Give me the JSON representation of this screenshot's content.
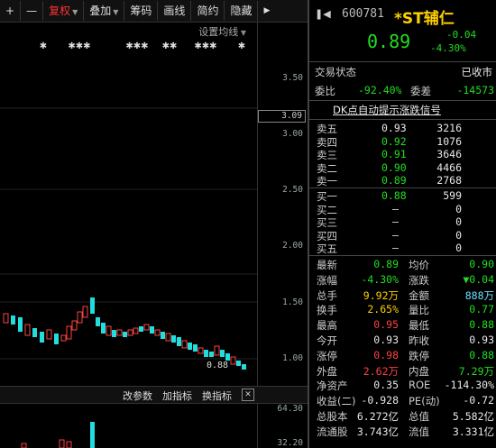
{
  "toolbar": {
    "plus": "+",
    "minus": "—",
    "fuquan": "复权",
    "diejia": "叠加",
    "chouma": "筹码",
    "huaxian": "画线",
    "jianyue": "简约",
    "yincang": "隐藏",
    "more": "▶"
  },
  "chart": {
    "avg_setting": "设置均线",
    "star_marks": [
      "✱",
      "✱✱✱",
      "✱✱✱",
      "✱✱",
      "✱✱✱",
      "✱"
    ],
    "y_ticks": [
      "3.50",
      "3.00",
      "2.50",
      "2.00",
      "1.50",
      "1.00"
    ],
    "current_price_tag": "3.09",
    "low_label": "0.88",
    "sub_ticks": [
      "64.30",
      "32.20"
    ],
    "sub_toolbar": {
      "change_params": "改参数",
      "add_indicator": "加指标",
      "switch_indicator": "换指标",
      "close": "✕"
    }
  },
  "quote": {
    "code": "600781",
    "name": "*ST辅仁",
    "price": "0.89",
    "change": "-0.04",
    "change_pct": "-4.30%",
    "status_label": "交易状态",
    "status_value": "已收市",
    "weibi_label": "委比",
    "weibi_value": "-92.40%",
    "weicha_label": "委差",
    "weicha_value": "-14573",
    "signal_link": "DK点自动提示涨跌信号"
  },
  "order_book": {
    "asks": [
      {
        "label": "卖五",
        "price": "0.93",
        "vol": "3216"
      },
      {
        "label": "卖四",
        "price": "0.92",
        "vol": "1076"
      },
      {
        "label": "卖三",
        "price": "0.91",
        "vol": "3646"
      },
      {
        "label": "卖二",
        "price": "0.90",
        "vol": "4466"
      },
      {
        "label": "卖一",
        "price": "0.89",
        "vol": "2768"
      }
    ],
    "bids": [
      {
        "label": "买一",
        "price": "0.88",
        "vol": "599"
      },
      {
        "label": "买二",
        "price": "—",
        "vol": "0"
      },
      {
        "label": "买三",
        "price": "—",
        "vol": "0"
      },
      {
        "label": "买四",
        "price": "—",
        "vol": "0"
      },
      {
        "label": "买五",
        "price": "—",
        "vol": "0"
      }
    ]
  },
  "stats": [
    {
      "l1": "最新",
      "v1": "0.89",
      "c1": "green",
      "l2": "均价",
      "v2": "0.90",
      "c2": "green"
    },
    {
      "l1": "涨幅",
      "v1": "-4.30%",
      "c1": "green",
      "l2": "涨跌",
      "v2": "▼0.04",
      "c2": "green"
    },
    {
      "l1": "总手",
      "v1": "9.92万",
      "c1": "yellow",
      "l2": "金额",
      "v2": "888万",
      "c2": "cyan"
    },
    {
      "l1": "换手",
      "v1": "2.65%",
      "c1": "yellow",
      "l2": "量比",
      "v2": "0.77",
      "c2": "green"
    },
    {
      "l1": "最高",
      "v1": "0.95",
      "c1": "red",
      "l2": "最低",
      "v2": "0.88",
      "c2": "green"
    },
    {
      "l1": "今开",
      "v1": "0.93",
      "c1": "white",
      "l2": "昨收",
      "v2": "0.93",
      "c2": "white"
    },
    {
      "l1": "涨停",
      "v1": "0.98",
      "c1": "red",
      "l2": "跌停",
      "v2": "0.88",
      "c2": "green"
    },
    {
      "l1": "外盘",
      "v1": "2.62万",
      "c1": "red",
      "l2": "内盘",
      "v2": "7.29万",
      "c2": "green"
    },
    {
      "l1": "净资产",
      "v1": "0.35",
      "c1": "white",
      "l2": "ROE",
      "v2": "-114.30%",
      "c2": "white"
    },
    {
      "l1": "收益(二)",
      "v1": "-0.928",
      "c1": "white",
      "l2": "PE(动)",
      "v2": "-0.72",
      "c2": "white"
    },
    {
      "l1": "总股本",
      "v1": "6.272亿",
      "c1": "white",
      "l2": "总值",
      "v2": "5.582亿",
      "c2": "white"
    },
    {
      "l1": "流通股",
      "v1": "3.743亿",
      "c1": "white",
      "l2": "流值",
      "v2": "3.331亿",
      "c2": "white"
    }
  ],
  "colors": {
    "up": "#ff4040",
    "down": "#22dddd",
    "accent": "#ffd000"
  }
}
